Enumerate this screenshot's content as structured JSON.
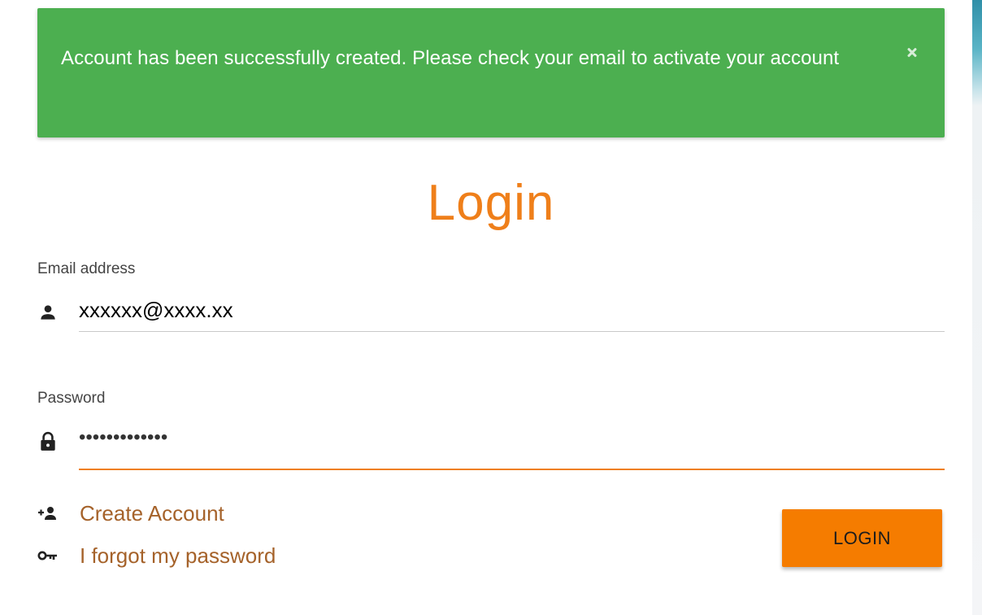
{
  "alert": {
    "message": "Account has been successfully created. Please check your email to activate your account",
    "close_icon": "close-icon",
    "color": "#4caf50"
  },
  "title": "Login",
  "email": {
    "label": "Email address",
    "value": "xxxxxx@xxxx.xx",
    "icon": "person-icon"
  },
  "password": {
    "label": "Password",
    "value": "•••••••••••••",
    "icon": "lock-icon"
  },
  "links": {
    "create_account": "Create Account",
    "create_account_icon": "person-add-icon",
    "forgot_password": "I forgot my password",
    "forgot_password_icon": "key-icon"
  },
  "login_button": "LOGIN",
  "colors": {
    "accent": "#ef7f1a",
    "button": "#f57c00",
    "link": "#a5622a"
  }
}
